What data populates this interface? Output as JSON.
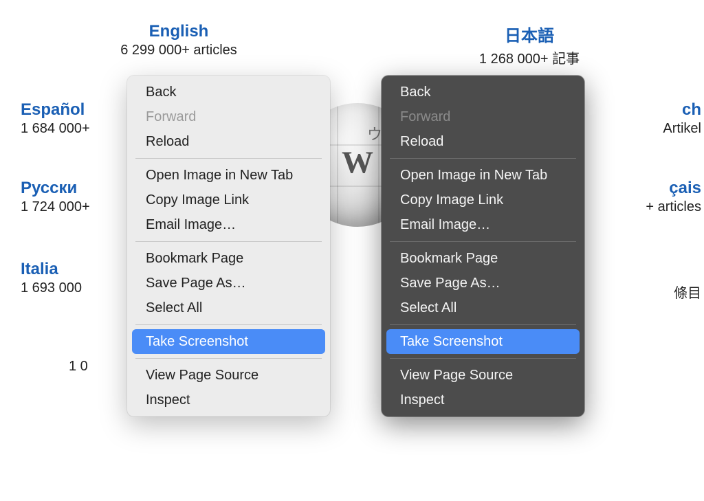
{
  "languages": {
    "english": {
      "name": "English",
      "sub": "6 299 000+ articles"
    },
    "japanese": {
      "name": "日本語",
      "sub": "1 268 000+ 記事"
    },
    "espanol": {
      "name": "Español",
      "sub": "1 684 000+"
    },
    "deutsch": {
      "name": "Deutsch",
      "sub": "Artikel"
    },
    "deutsch_suffix": "ch",
    "russkiy": {
      "name": "Русский",
      "sub": "1 724 000+"
    },
    "russkiy_visible": "Русски",
    "francais": {
      "name": "Français",
      "sub": "+ articles"
    },
    "francais_suffix": "çais",
    "italiano": {
      "name": "Italiano",
      "sub": "1 693 000"
    },
    "italiano_visible": "Italia",
    "chinese_sub": "條目",
    "portugues_sub_visible": "1 0"
  },
  "menu": {
    "back": "Back",
    "forward": "Forward",
    "reload": "Reload",
    "open_image": "Open Image in New Tab",
    "copy_image_link": "Copy Image Link",
    "email_image": "Email Image…",
    "bookmark_page": "Bookmark Page",
    "save_page_as": "Save Page As…",
    "select_all": "Select All",
    "take_screenshot": "Take Screenshot",
    "view_page_source": "View Page Source",
    "inspect": "Inspect"
  },
  "globe": {
    "letter": "W",
    "jp": "ウィ"
  }
}
